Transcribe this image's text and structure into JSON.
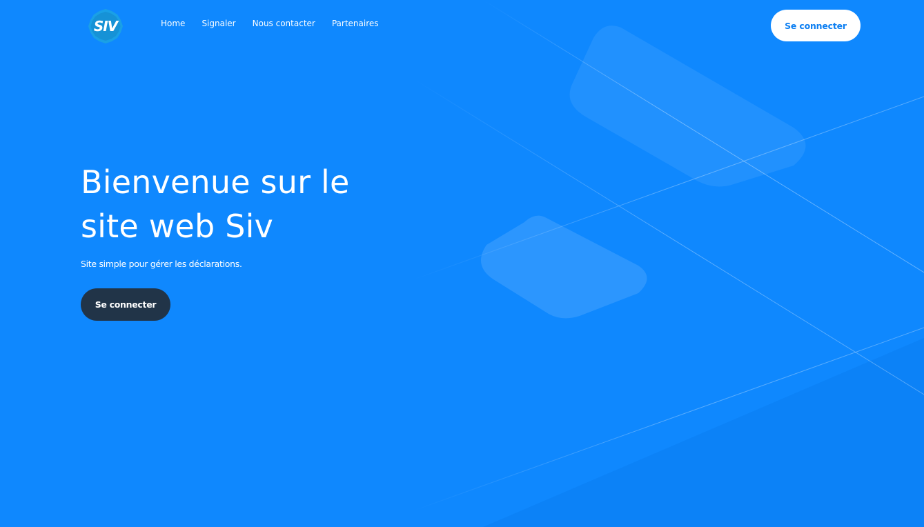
{
  "brand": {
    "logo_text": "SIV"
  },
  "nav": {
    "items": [
      {
        "label": "Home"
      },
      {
        "label": "Signaler"
      },
      {
        "label": "Nous contacter"
      },
      {
        "label": "Partenaires"
      }
    ]
  },
  "header": {
    "login_label": "Se connecter"
  },
  "hero": {
    "title": "Bienvenue sur le site web Siv",
    "subtitle": "Site simple pour gérer les déclarations.",
    "cta_label": "Se connecter"
  },
  "colors": {
    "background": "#0f88fe",
    "logo_badge": "#1aa0e6",
    "header_button_bg": "#ffffff",
    "header_button_text": "#0d7ff2",
    "cta_button_bg": "#213448",
    "text": "#ffffff"
  }
}
